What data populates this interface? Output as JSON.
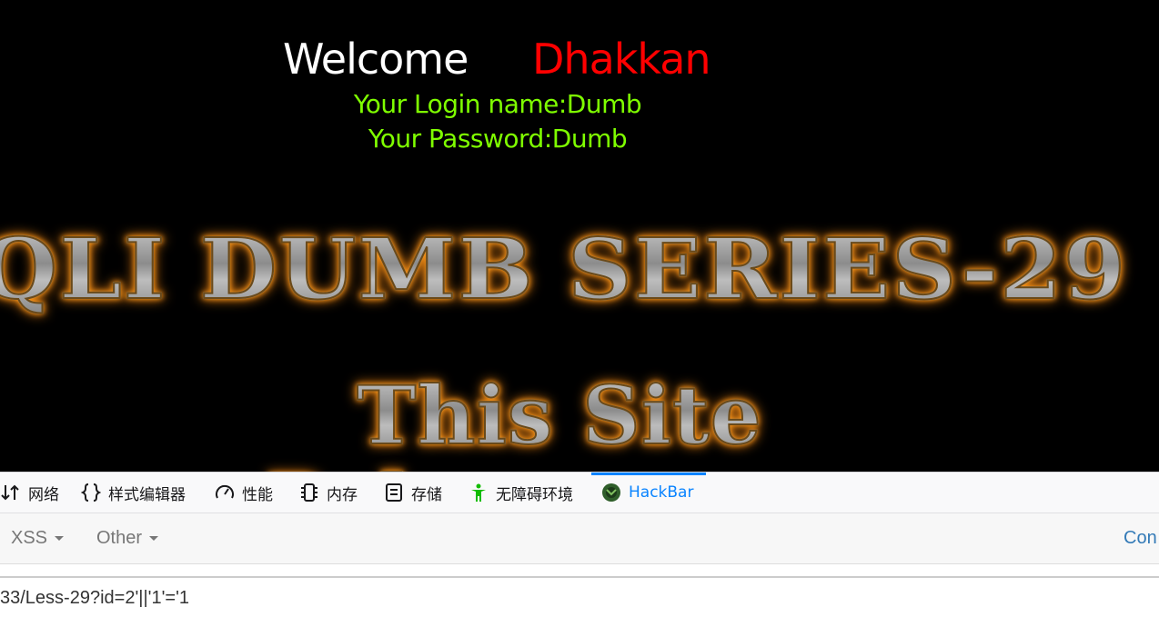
{
  "content": {
    "welcome_word": "Welcome",
    "welcome_name": "Dhakkan",
    "login_name_line": "Your Login name:Dumb",
    "password_line": "Your Password:Dumb",
    "banner_series": "QLI DUMB SERIES-29",
    "banner_site": "This Site",
    "banner_next": "P         d",
    "colors": {
      "welcome": "#ffffff",
      "name": "#ff0000",
      "login_info": "#7fff00",
      "banner_glow": "#ff9a1a"
    }
  },
  "devtools": {
    "tabs": [
      {
        "label": "网络",
        "icon": "network-arrows-icon"
      },
      {
        "label": "样式编辑器",
        "icon": "braces-icon"
      },
      {
        "label": "性能",
        "icon": "gauge-icon"
      },
      {
        "label": "内存",
        "icon": "memory-chip-icon"
      },
      {
        "label": "存储",
        "icon": "storage-icon"
      },
      {
        "label": "无障碍环境",
        "icon": "accessibility-person-icon"
      },
      {
        "label": "HackBar",
        "icon": "hackbar-logo-icon",
        "active": true
      }
    ],
    "accent_color": "#0a84ff"
  },
  "hackbar": {
    "menus": [
      {
        "label": "XSS"
      },
      {
        "label": "Other"
      }
    ],
    "contribute_label": "Con",
    "url_value": "33/Less-29?id=2'||'1'='1"
  }
}
